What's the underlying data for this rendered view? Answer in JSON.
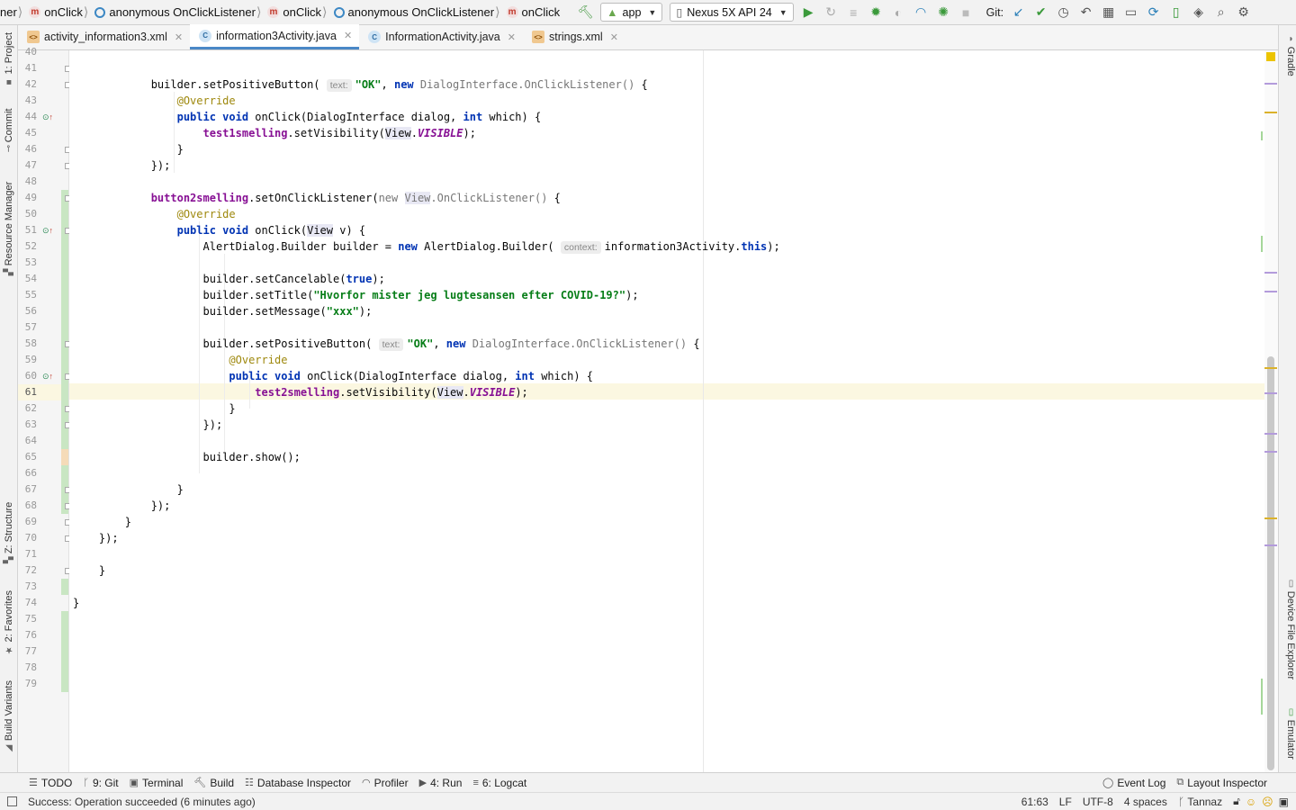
{
  "navbar": {
    "breadcrumbs": [
      {
        "kind": "text",
        "label": "ner"
      },
      {
        "kind": "method",
        "label": "onClick"
      },
      {
        "kind": "anon",
        "label": "anonymous OnClickListener"
      },
      {
        "kind": "method",
        "label": "onClick"
      },
      {
        "kind": "anon",
        "label": "anonymous OnClickListener"
      },
      {
        "kind": "method",
        "label": "onClick"
      }
    ],
    "module_combo": "app",
    "device_combo": "Nexus 5X API 24",
    "git_label": "Git:"
  },
  "tabs": [
    {
      "label": "activity_information3.xml",
      "icon": "xml-file-icon",
      "active": false
    },
    {
      "label": "information3Activity.java",
      "icon": "java-class-icon",
      "active": true
    },
    {
      "label": "InformationActivity.java",
      "icon": "java-class-icon",
      "active": false
    },
    {
      "label": "strings.xml",
      "icon": "xml-file-icon",
      "active": false
    }
  ],
  "left_tools": [
    "1: Project",
    "Commit",
    "Resource Manager",
    "Z: Structure",
    "2: Favorites",
    "Build Variants"
  ],
  "right_tools": [
    "Gradle",
    "Device File Explorer",
    "Emulator"
  ],
  "editor": {
    "first_line": 40,
    "last_line": 79,
    "current_line": 61,
    "hints": {
      "text": "text:",
      "context": "context:"
    },
    "strings": {
      "ok": "\"OK\"",
      "title": "\"Hvorfor mister jeg lugtesansen efter COVID-19?\"",
      "message": "\"xxx\""
    }
  },
  "bottom_tools": [
    {
      "label": "TODO",
      "icon": "todo-icon"
    },
    {
      "label": "9: Git",
      "icon": "git-branch-icon"
    },
    {
      "label": "Terminal",
      "icon": "terminal-icon"
    },
    {
      "label": "Build",
      "icon": "hammer-icon"
    },
    {
      "label": "Database Inspector",
      "icon": "database-icon"
    },
    {
      "label": "Profiler",
      "icon": "profiler-icon"
    },
    {
      "label": "4: Run",
      "icon": "run-icon"
    },
    {
      "label": "6: Logcat",
      "icon": "logcat-icon"
    }
  ],
  "bottom_right_tools": [
    {
      "label": "Event Log",
      "icon": "event-log-icon"
    },
    {
      "label": "Layout Inspector",
      "icon": "layout-inspector-icon"
    }
  ],
  "status": {
    "message": "Success: Operation succeeded (6 minutes ago)",
    "position": "61:63",
    "line_sep": "LF",
    "encoding": "UTF-8",
    "indent": "4 spaces",
    "branch": "Tannaz"
  },
  "colors": {
    "accent": "#4a88c7",
    "keyword": "#0033b3",
    "string": "#067d17",
    "field": "#871094",
    "annotation": "#9e880d",
    "vcs_added": "#c9e6c3",
    "vcs_modified": "#f5dbb8",
    "current_line": "#fbf7e1"
  }
}
